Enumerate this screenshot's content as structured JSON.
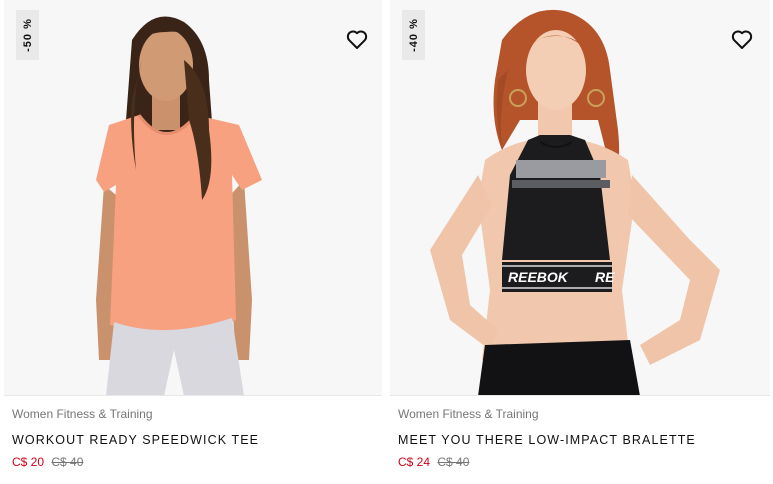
{
  "products": [
    {
      "discount": "-50 %",
      "category": "Women Fitness & Training",
      "name": "WORKOUT READY SPEEDWICK TEE",
      "sale_price": "C$ 20",
      "original_price": "C$ 40",
      "wishlist_icon": "heart-outline-icon"
    },
    {
      "discount": "-40 %",
      "category": "Women Fitness & Training",
      "name": "MEET YOU THERE LOW-IMPACT BRALETTE",
      "sale_price": "C$ 24",
      "original_price": "C$ 40",
      "wishlist_icon": "heart-outline-icon",
      "print_text": "REEBOK"
    }
  ],
  "colors": {
    "sale": "#d0021b",
    "muted": "#767677",
    "text": "#111111",
    "badge_bg": "#e9e9e9"
  }
}
